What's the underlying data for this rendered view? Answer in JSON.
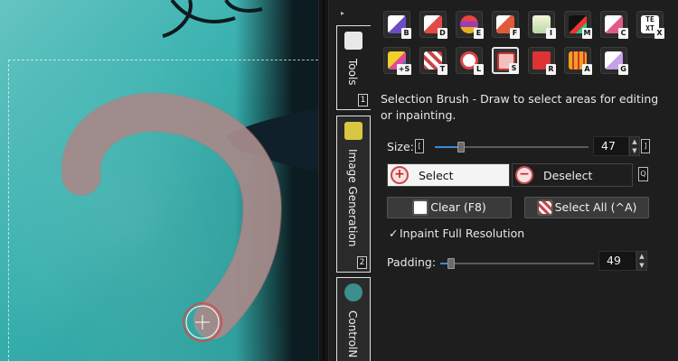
{
  "canvas": {
    "description": ""
  },
  "tabs": [
    {
      "label": "Tools",
      "key": "1",
      "icon": "tools-icon",
      "color": "#e8e8e8"
    },
    {
      "label": "Image Generation",
      "key": "2",
      "icon": "sparkle-icon",
      "color": "#d9c642"
    },
    {
      "label": "ControlN",
      "key": "",
      "icon": "controlnet-icon",
      "color": "#3b8f8c"
    }
  ],
  "tools": [
    {
      "icon": "brush-icon",
      "key": "B"
    },
    {
      "icon": "draw-icon",
      "key": "D"
    },
    {
      "icon": "eraser-layers-icon",
      "key": "E"
    },
    {
      "icon": "fill-icon",
      "key": "F"
    },
    {
      "icon": "filter-icon",
      "key": "I"
    },
    {
      "icon": "smudge-icon",
      "key": "M"
    },
    {
      "icon": "eyedropper-icon",
      "key": "C"
    },
    {
      "icon": "text-icon",
      "key": "X",
      "text": "TE XT"
    },
    {
      "icon": "layer-shapes-icon",
      "key": "+S"
    },
    {
      "icon": "transform-icon",
      "key": "T"
    },
    {
      "icon": "lasso-icon",
      "key": "L"
    },
    {
      "icon": "selection-brush-icon",
      "key": "S"
    },
    {
      "icon": "rect-select-icon",
      "key": "R"
    },
    {
      "icon": "generation-area-icon",
      "key": "A"
    },
    {
      "icon": "shape-select-icon",
      "key": "G"
    }
  ],
  "panel": {
    "description": "Selection Brush - Draw to select areas for editing or inpainting.",
    "size_label": "Size:",
    "size_key": "[",
    "size_value": "47",
    "size_key_right": "]",
    "size_fraction": 0.17,
    "select_label": "Select",
    "deselect_label": "Deselect",
    "deselect_key": "Q",
    "clear_label": "Clear (F8)",
    "select_all_label": "Select All (^A)",
    "inpaint_mark": "✓",
    "inpaint_label": "Inpaint Full Resolution",
    "padding_label": "Padding:",
    "padding_value": "49",
    "padding_fraction": 0.07
  },
  "colors": {
    "accent": "#3a8bd6",
    "selection_outline": "#d24a4a",
    "panel_bg": "#1e1e1e"
  }
}
